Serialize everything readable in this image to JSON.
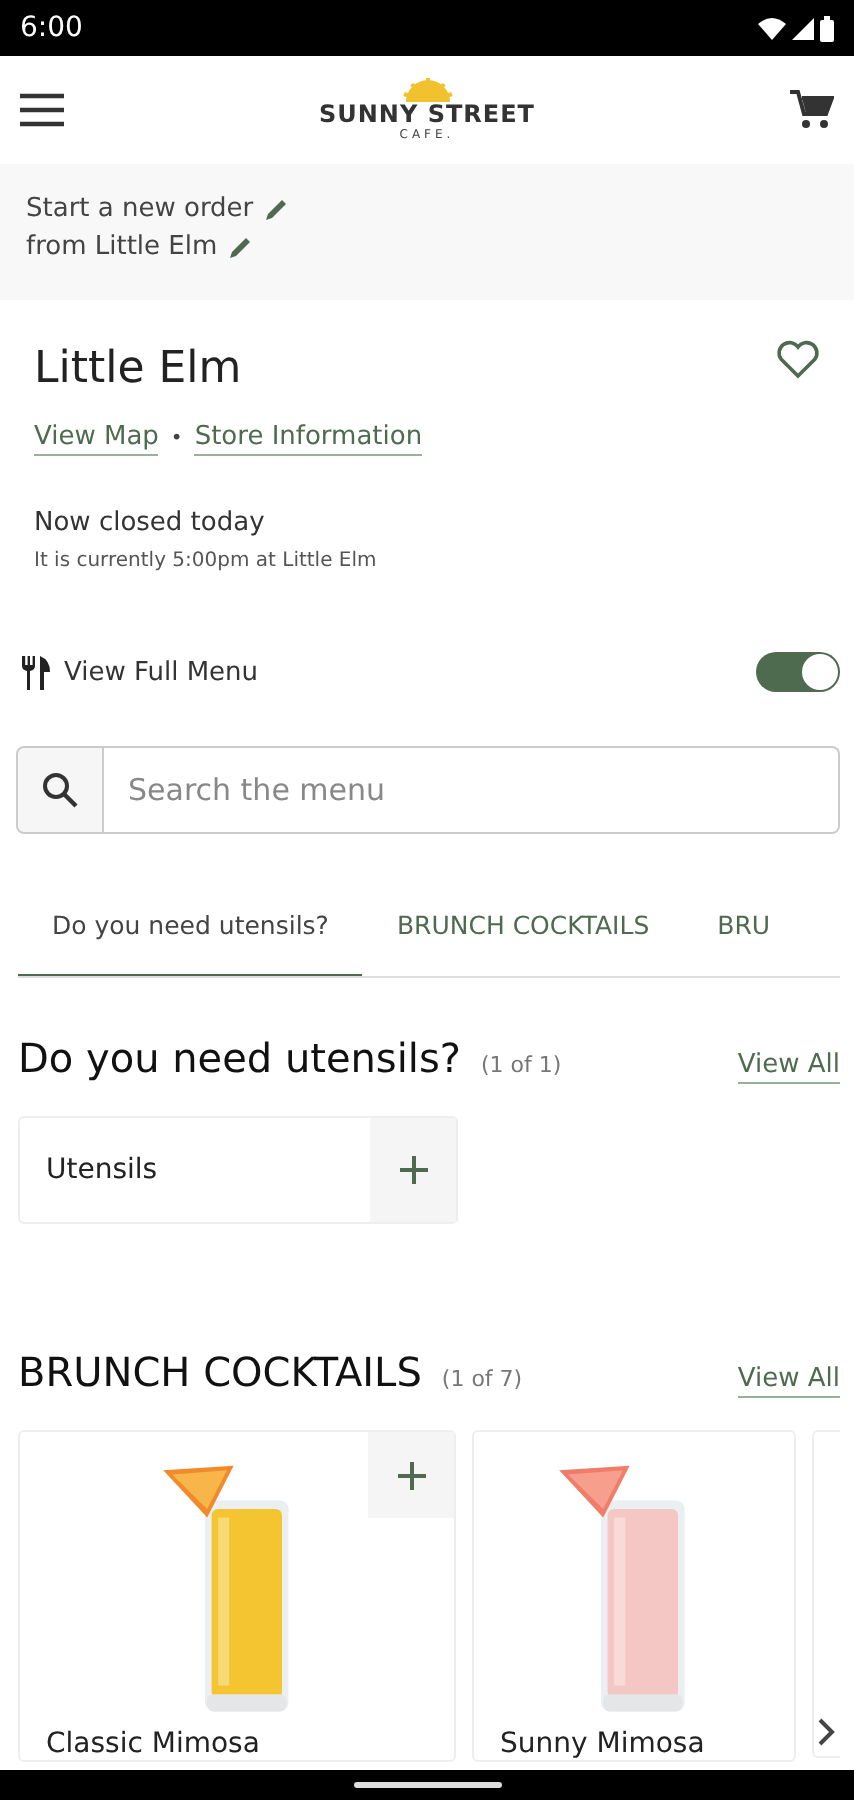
{
  "status_bar": {
    "time": "6:00"
  },
  "header": {
    "logo_name": "SUNNY STREET",
    "logo_sub": "CAFE."
  },
  "order": {
    "line_1": "Start a new order",
    "line_2": "from Little Elm"
  },
  "store": {
    "name": "Little Elm",
    "favorite": false,
    "links": [
      "View Map",
      "Store Information"
    ],
    "separator": "•",
    "status": "Now closed today",
    "note": "It is currently 5:00pm at Little Elm"
  },
  "full_menu": {
    "label": "View Full Menu",
    "on": true
  },
  "search": {
    "placeholder": "Search the menu"
  },
  "tabs": [
    {
      "label": "Do you need utensils?",
      "selected": true
    },
    {
      "label": "BRUNCH COCKTAILS",
      "selected": false
    },
    {
      "label": "BRU",
      "selected": false
    }
  ],
  "sections": [
    {
      "title": "Do you need utensils?",
      "count": "(1 of 1)",
      "link": "View All",
      "items": [
        {
          "kind": "plain",
          "name": "Utensils"
        }
      ]
    },
    {
      "title": "BRUNCH COCKTAILS",
      "count": "(1 of 7)",
      "link": "View All",
      "items": [
        {
          "kind": "picture",
          "name": "Classic Mimosa"
        },
        {
          "kind": "picture",
          "name": "Sunny Mimosa"
        }
      ]
    }
  ]
}
